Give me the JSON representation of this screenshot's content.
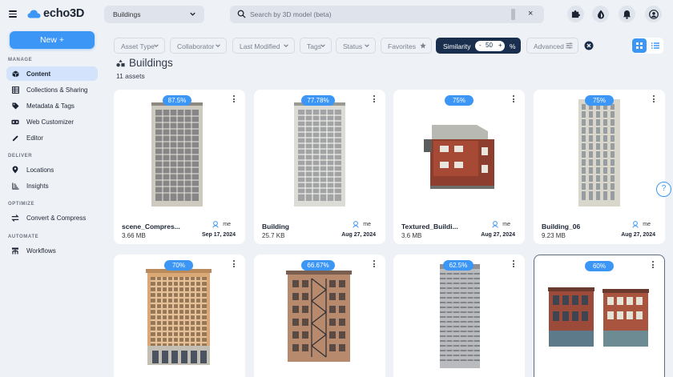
{
  "app": {
    "logo_text": "echo3D"
  },
  "header": {
    "project": "Buildings",
    "search_placeholder": "Search by 3D model (beta)",
    "clear_label": "×"
  },
  "sidebar": {
    "new_label": "New +",
    "sections": {
      "manage": "MANAGE",
      "deliver": "DELIVER",
      "optimize": "OPTIMIZE",
      "automate": "AUTOMATE"
    },
    "items": [
      {
        "label": "Content",
        "icon": "cube-icon"
      },
      {
        "label": "Collections & Sharing",
        "icon": "table-icon"
      },
      {
        "label": "Metadata & Tags",
        "icon": "tag-icon"
      },
      {
        "label": "Web Customizer",
        "icon": "vr-headset-icon"
      },
      {
        "label": "Editor",
        "icon": "pencil-icon"
      },
      {
        "label": "Locations",
        "icon": "pin-icon"
      },
      {
        "label": "Insights",
        "icon": "chart-icon"
      },
      {
        "label": "Convert & Compress",
        "icon": "convert-icon"
      },
      {
        "label": "Workflows",
        "icon": "workflow-icon"
      }
    ]
  },
  "filters": {
    "asset_type": "Asset Type",
    "collaborator": "Collaborator",
    "last_modified": "Last Modified",
    "tags": "Tags",
    "status": "Status",
    "favorites": "Favorites",
    "similarity": "Similarity",
    "similarity_value": "50",
    "similarity_minus": "-",
    "similarity_plus": "+",
    "similarity_unit": "%",
    "advanced": "Advanced"
  },
  "main": {
    "title": "Buildings",
    "count": "11 assets",
    "help": "?"
  },
  "assets": [
    {
      "similarity": "87.5%",
      "name": "scene_Compres...",
      "size": "3.66 MB",
      "owner": "me",
      "date": "Sep 17, 2024"
    },
    {
      "similarity": "77.78%",
      "name": "Building",
      "size": "25.7 KB",
      "owner": "me",
      "date": "Aug 27, 2024"
    },
    {
      "similarity": "75%",
      "name": "Textured_Buildi...",
      "size": "3.6 MB",
      "owner": "me",
      "date": "Aug 27, 2024"
    },
    {
      "similarity": "75%",
      "name": "Building_06",
      "size": "9.23 MB",
      "owner": "me",
      "date": "Aug 27, 2024"
    },
    {
      "similarity": "70%"
    },
    {
      "similarity": "66.67%"
    },
    {
      "similarity": "62.5%"
    },
    {
      "similarity": "60%"
    }
  ],
  "colors": {
    "accent": "#3b96f5",
    "dark": "#1a2e4d",
    "background": "#eef1f6"
  }
}
